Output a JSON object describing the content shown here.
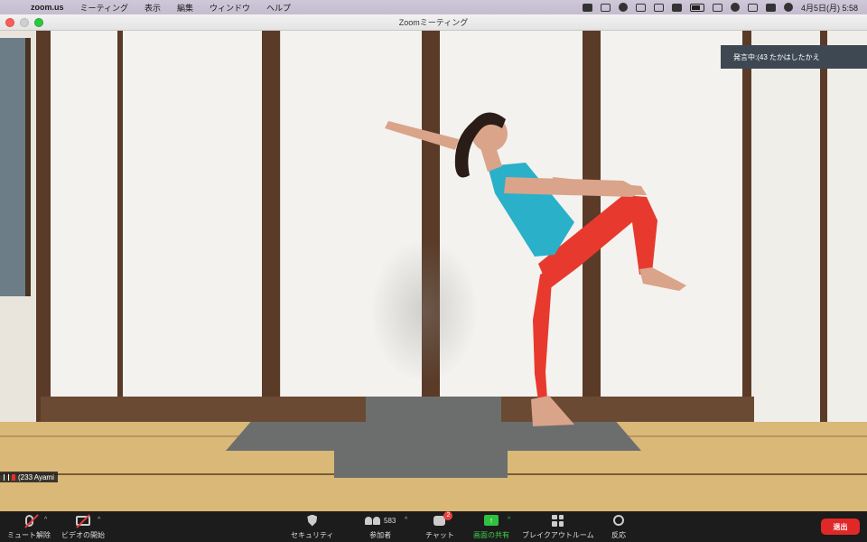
{
  "menubar": {
    "apple_icon": "apple-icon",
    "app_name": "zoom.us",
    "menus": [
      "ミーティング",
      "表示",
      "編集",
      "ウィンドウ",
      "ヘルプ"
    ],
    "clock": "4月5日(月)  5:58",
    "status_icons": [
      "zoom-icon",
      "dropbox-icon",
      "line-icon",
      "cloud-icon",
      "shield-icon",
      "input-method-icon",
      "battery-icon",
      "bluetooth-icon",
      "wifi-icon",
      "search-icon",
      "control-center-icon",
      "siri-icon"
    ]
  },
  "window": {
    "title": "Zoomミーティング"
  },
  "video": {
    "speaking_banner": "発言中:(43 たかはしたかえ",
    "name_tag": "(233 Ayami"
  },
  "controls": {
    "unmute_label": "ミュート解除",
    "start_video_label": "ビデオの開始",
    "security_label": "セキュリティ",
    "participants_label": "参加者",
    "participants_count": "583",
    "chat_label": "チャット",
    "chat_badge": "2",
    "share_label": "画面の共有",
    "breakout_label": "ブレイクアウトルーム",
    "reactions_label": "反応",
    "end_label": "退出"
  },
  "colors": {
    "end_button": "#e02828",
    "share_green": "#2fc23f",
    "badge_red": "#e8433c",
    "control_bar": "#1c1c1c"
  }
}
